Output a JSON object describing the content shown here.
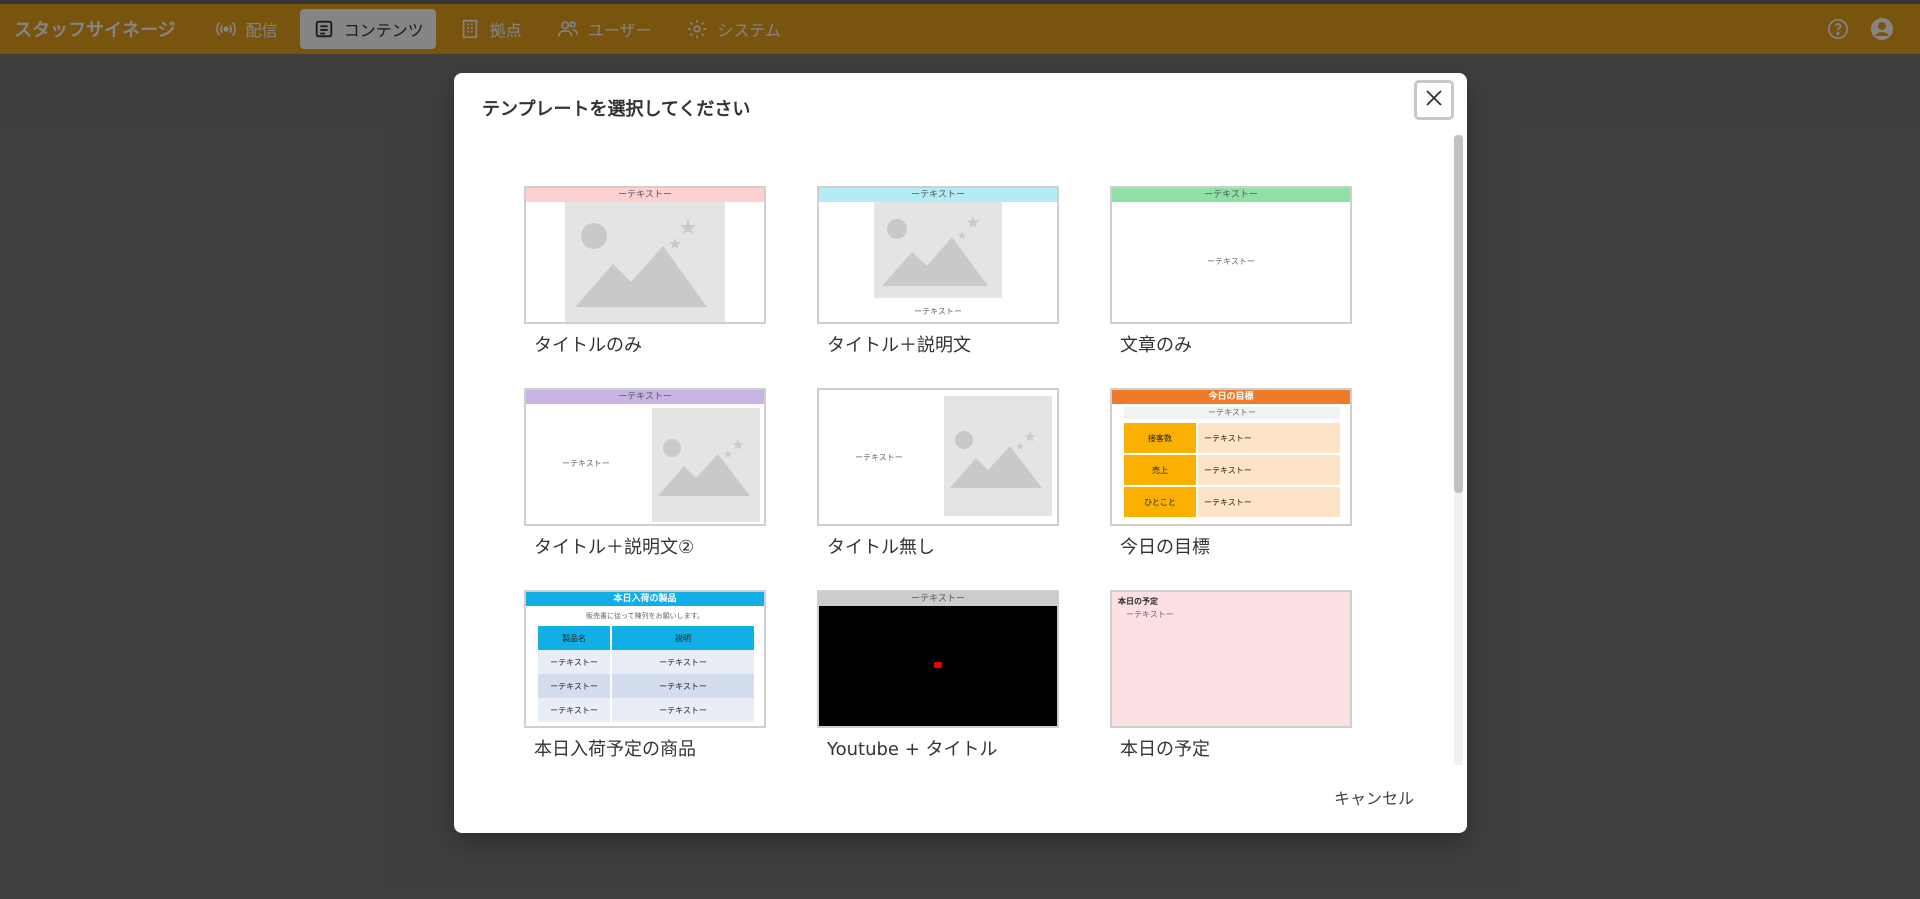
{
  "app": {
    "brand": "スタッフサイネージ",
    "nav": [
      {
        "label": "配信",
        "icon": "broadcast-icon"
      },
      {
        "label": "コンテンツ",
        "icon": "document-icon",
        "active": true
      },
      {
        "label": "拠点",
        "icon": "building-icon"
      },
      {
        "label": "ユーザー",
        "icon": "users-icon"
      },
      {
        "label": "システム",
        "icon": "gear-icon"
      }
    ],
    "colors": {
      "bar": "#e7a21e"
    }
  },
  "dialog": {
    "title": "テンプレートを選択してください",
    "cancel_label": "キャンセル",
    "templates": [
      {
        "label": "タイトルのみ",
        "bar_text": "ーテキストー",
        "bar_color": "#ffd0d0"
      },
      {
        "label": "タイトル＋説明文",
        "bar_text": "ーテキストー",
        "bar_color": "#b4ecf6",
        "sub_text": "ーテキストー"
      },
      {
        "label": "文章のみ",
        "bar_text": "ーテキストー",
        "bar_color": "#8fe0a6",
        "body_text": "ーテキストー"
      },
      {
        "label": "タイトル＋説明文②",
        "bar_text": "ーテキストー",
        "bar_color": "#c8b4e4",
        "side_text": "ーテキストー"
      },
      {
        "label": "タイトル無し",
        "side_text": "ーテキストー"
      },
      {
        "label": "今日の目標",
        "bar_text": "今日の目標",
        "bar_color": "#ee7a2a",
        "sub_text": "ーテキストー",
        "rows": [
          {
            "key": "接客数",
            "value": "ーテキストー"
          },
          {
            "key": "売上",
            "value": "ーテキストー"
          },
          {
            "key": "ひとこと",
            "value": "ーテキストー"
          }
        ]
      },
      {
        "label": "本日入荷予定の商品",
        "bar_text": "本日入荷の製品",
        "bar_color": "#12aee6",
        "note": "販売書に従って陳列をお願いします。",
        "headers": [
          "製品名",
          "説明"
        ],
        "rows": [
          [
            "ーテキストー",
            "ーテキストー"
          ],
          [
            "ーテキストー",
            "ーテキストー"
          ],
          [
            "ーテキストー",
            "ーテキストー"
          ]
        ]
      },
      {
        "label": "Youtube + タイトル",
        "bar_text": "ーテキストー",
        "bar_color": "#cccccc"
      },
      {
        "label": "本日の予定",
        "heading": "本日の予定",
        "body_text": "ーテキストー",
        "bg_color": "#fde0e4"
      }
    ]
  }
}
